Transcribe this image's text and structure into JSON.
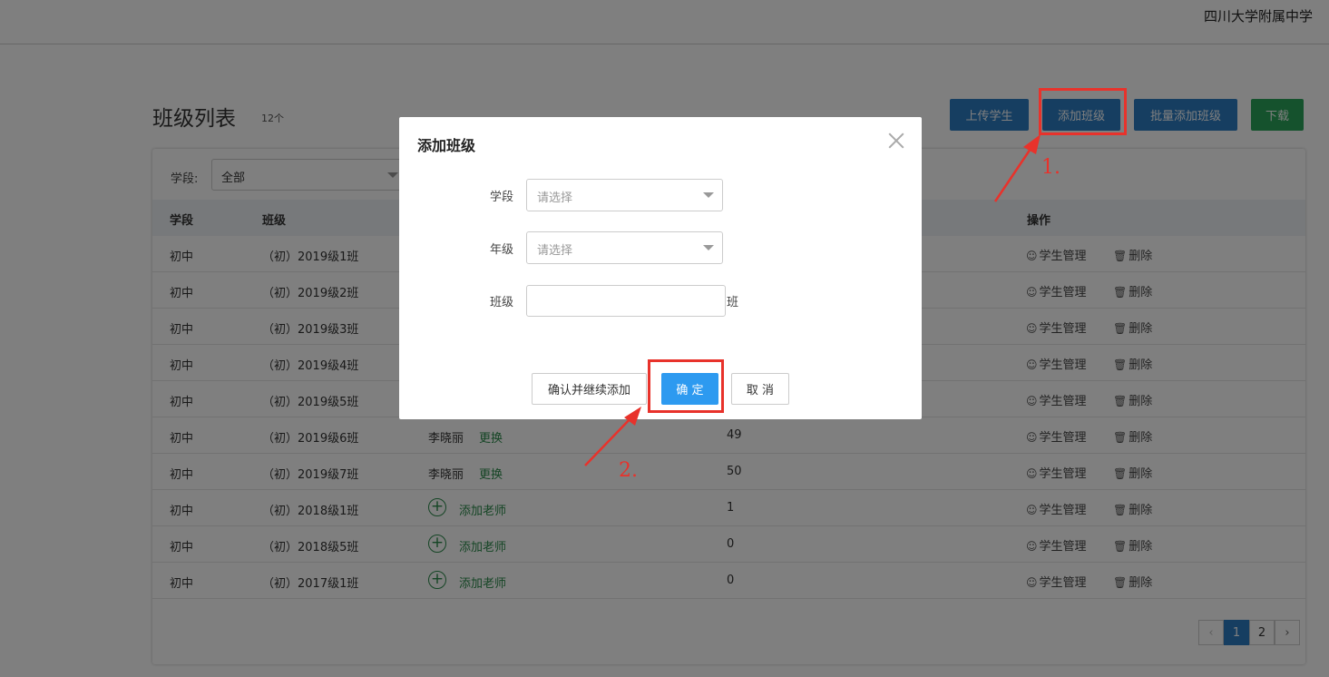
{
  "header": {
    "school_name": "四川大学附属中学"
  },
  "page": {
    "title": "班级列表",
    "count": "12个"
  },
  "actions": {
    "upload_students": "上传学生",
    "add_class": "添加班级",
    "batch_add_class": "批量添加班级",
    "download": "下载"
  },
  "filter": {
    "label": "学段:",
    "value": "全部"
  },
  "table": {
    "headers": {
      "stage": "学段",
      "class": "班级",
      "ops": "操作"
    },
    "rows": [
      {
        "stage": "初中",
        "class": "（初）2019级1班"
      },
      {
        "stage": "初中",
        "class": "（初）2019级2班"
      },
      {
        "stage": "初中",
        "class": "（初）2019级3班"
      },
      {
        "stage": "初中",
        "class": "（初）2019级4班"
      },
      {
        "stage": "初中",
        "class": "（初）2019级5班"
      },
      {
        "stage": "初中",
        "class": "（初）2019级6班",
        "teacher": "李晓丽",
        "teacher_action": "更换",
        "students": "49"
      },
      {
        "stage": "初中",
        "class": "（初）2019级7班",
        "teacher": "李晓丽",
        "teacher_action": "更换",
        "students": "50"
      },
      {
        "stage": "初中",
        "class": "（初）2018级1班",
        "teacher_action": "添加老师",
        "students": "1"
      },
      {
        "stage": "初中",
        "class": "（初）2018级5班",
        "teacher_action": "添加老师",
        "students": "0"
      },
      {
        "stage": "初中",
        "class": "（初）2017级1班",
        "teacher_action": "添加老师",
        "students": "0"
      }
    ],
    "op_manage": "学生管理",
    "op_delete": "删除"
  },
  "pagination": {
    "prev": "‹",
    "pages": [
      "1",
      "2"
    ],
    "current": "1",
    "next": "›"
  },
  "modal": {
    "title": "添加班级",
    "stage_label": "学段",
    "stage_placeholder": "请选择",
    "grade_label": "年级",
    "grade_placeholder": "请选择",
    "class_label": "班级",
    "class_suffix": "班",
    "confirm_continue": "确认并继续添加",
    "confirm": "确 定",
    "cancel": "取 消"
  },
  "annotations": {
    "step1": "1.",
    "step2": "2.",
    "color": "#e8322b"
  },
  "colors": {
    "primary_blue": "#2c7dc3",
    "download_green": "#2aa55b",
    "confirm_blue": "#2d9af0",
    "link_green": "#2a8a4a"
  }
}
